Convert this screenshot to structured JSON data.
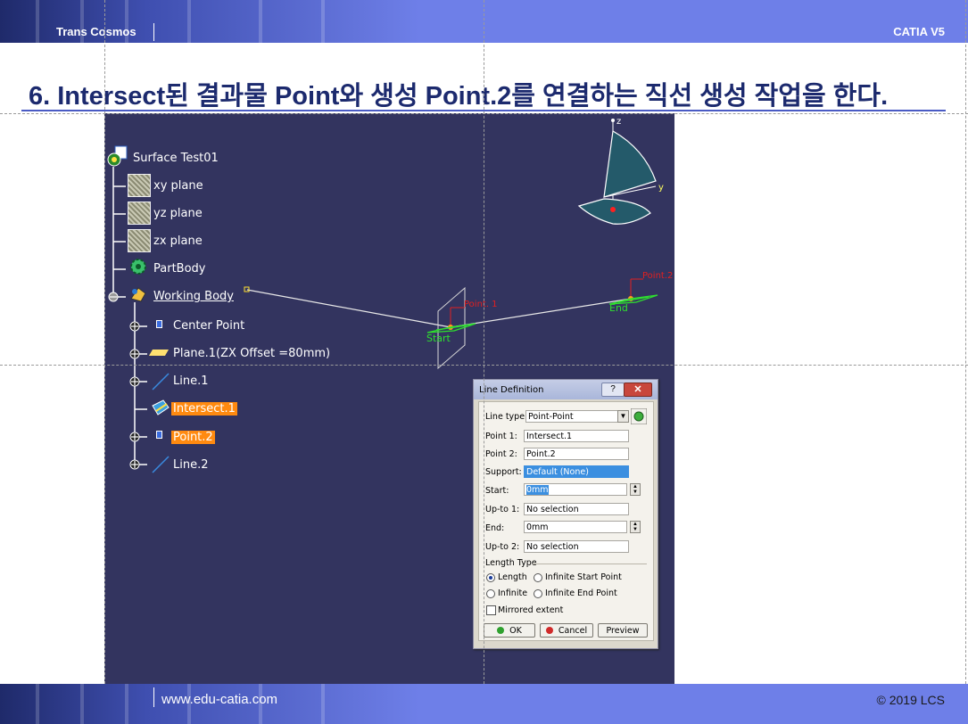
{
  "header": {
    "brand": "Trans Cosmos",
    "product": "CATIA V5"
  },
  "slide": {
    "title": "6. Intersect된 결과물 Point와 생성 Point.2를 연결하는 직선 생성 작업을 한다."
  },
  "tree": {
    "root": "Surface Test01",
    "items": [
      {
        "label": "xy plane",
        "icon": "plane-icon"
      },
      {
        "label": "yz plane",
        "icon": "plane-icon"
      },
      {
        "label": "zx plane",
        "icon": "plane-icon"
      },
      {
        "label": "PartBody",
        "icon": "gear-icon"
      },
      {
        "label": "Working Body",
        "icon": "body-icon"
      }
    ],
    "children": [
      {
        "label": "Center Point",
        "icon": "point-icon"
      },
      {
        "label": "Plane.1(ZX Offset =80mm)",
        "icon": "plane-icon"
      },
      {
        "label": "Line.1",
        "icon": "line-icon"
      },
      {
        "label": "Intersect.1",
        "icon": "intersect-icon"
      },
      {
        "label": "Point.2",
        "icon": "point-icon"
      },
      {
        "label": "Line.2",
        "icon": "line-icon"
      }
    ]
  },
  "viewport": {
    "point1_label": "Point. 1",
    "point2_label": "Point.2",
    "start_label": "Start",
    "end_label": "End",
    "axis_z": "z",
    "axis_y": "y"
  },
  "dialog": {
    "title": "Line Definition",
    "help": "?",
    "close": "✕",
    "line_type_label": "Line type :",
    "line_type_value": "Point-Point",
    "point1_label": "Point 1:",
    "point1_value": "Intersect.1",
    "point2_label": "Point 2:",
    "point2_value": "Point.2",
    "support_label": "Support:",
    "support_value": "Default (None)",
    "start_label": "Start:",
    "start_value": "0mm",
    "upto1_label": "Up-to 1:",
    "upto1_value": "No selection",
    "end_label": "End:",
    "end_value": "0mm",
    "upto2_label": "Up-to 2:",
    "upto2_value": "No selection",
    "length_type_label": "Length Type",
    "radio_length": "Length",
    "radio_inf_start": "Infinite Start Point",
    "radio_infinite": "Infinite",
    "radio_inf_end": "Infinite End Point",
    "mirrored": "Mirrored extent",
    "ok": "OK",
    "cancel": "Cancel",
    "preview": "Preview"
  },
  "footer": {
    "url": "www.edu-catia.com",
    "copyright": "© 2019 LCS"
  },
  "colors": {
    "header_blue": "#6e7fe8",
    "title_navy": "#1c2a6e",
    "viewport_bg": "#33345f",
    "highlight_orange": "#ff8a10",
    "geometry_green": "#2ee02e"
  }
}
